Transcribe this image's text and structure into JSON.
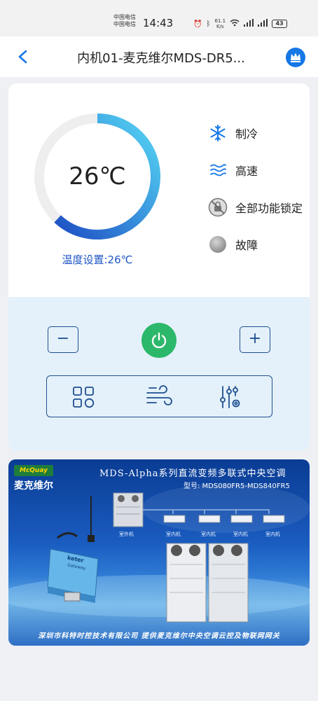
{
  "status_bar": {
    "carrier_1": "中国电信",
    "carrier_2": "中国电信",
    "time": "14:43",
    "net_speed_value": "61.1",
    "net_speed_unit": "K/s",
    "network_1": "4G",
    "network_2": "4G",
    "battery": "43"
  },
  "header": {
    "title": "内机01-麦克维尔MDS-DR5...",
    "back_icon": "chevron-left-icon",
    "crown_icon": "crown-icon",
    "accent": "#1677e6"
  },
  "thermostat": {
    "temperature": "26℃",
    "setting_label": "温度设置:26℃",
    "gauge_level": 0.62,
    "gauge_colors": [
      "#1d4fc4",
      "#56d8f5"
    ]
  },
  "status_list": [
    {
      "label": "制冷",
      "icon": "snowflake-icon"
    },
    {
      "label": "高速",
      "icon": "wind-waves-icon"
    },
    {
      "label": "全部功能锁定",
      "icon": "lock-disabled-icon"
    },
    {
      "label": "故障",
      "icon": "fault-dot-icon"
    }
  ],
  "controls": {
    "decrease": "−",
    "increase": "+",
    "power_icon": "power-icon",
    "power_color": "#2cb86a",
    "functions": [
      {
        "icon": "mode-grid-icon"
      },
      {
        "icon": "fan-wind-icon"
      },
      {
        "icon": "settings-sliders-icon"
      }
    ]
  },
  "banner": {
    "logo_en": "McQuay",
    "logo_cn": "麦克维尔",
    "title": "MDS-Alpha系列直流变频多联式中央空调",
    "model": "型号: MDS080FR5-MDS840FR5",
    "outdoor_label": "室外机",
    "indoor_labels": [
      "室内机",
      "室内机",
      "室内机",
      "室内机"
    ],
    "gateway_brand": "keter",
    "gateway_text": "Gateway",
    "footer": "深圳市科特时控技术有限公司   提供麦克维尔中央空调云控及物联网网关"
  }
}
